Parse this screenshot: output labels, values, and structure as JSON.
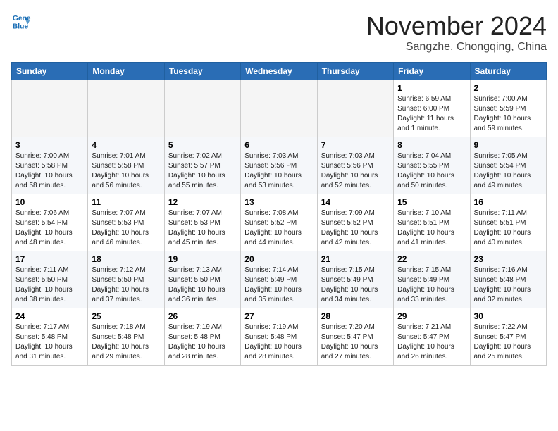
{
  "header": {
    "logo_line1": "General",
    "logo_line2": "Blue",
    "month": "November 2024",
    "location": "Sangzhe, Chongqing, China"
  },
  "weekdays": [
    "Sunday",
    "Monday",
    "Tuesday",
    "Wednesday",
    "Thursday",
    "Friday",
    "Saturday"
  ],
  "weeks": [
    [
      {
        "day": "",
        "info": ""
      },
      {
        "day": "",
        "info": ""
      },
      {
        "day": "",
        "info": ""
      },
      {
        "day": "",
        "info": ""
      },
      {
        "day": "",
        "info": ""
      },
      {
        "day": "1",
        "info": "Sunrise: 6:59 AM\nSunset: 6:00 PM\nDaylight: 11 hours and 1 minute."
      },
      {
        "day": "2",
        "info": "Sunrise: 7:00 AM\nSunset: 5:59 PM\nDaylight: 10 hours and 59 minutes."
      }
    ],
    [
      {
        "day": "3",
        "info": "Sunrise: 7:00 AM\nSunset: 5:58 PM\nDaylight: 10 hours and 58 minutes."
      },
      {
        "day": "4",
        "info": "Sunrise: 7:01 AM\nSunset: 5:58 PM\nDaylight: 10 hours and 56 minutes."
      },
      {
        "day": "5",
        "info": "Sunrise: 7:02 AM\nSunset: 5:57 PM\nDaylight: 10 hours and 55 minutes."
      },
      {
        "day": "6",
        "info": "Sunrise: 7:03 AM\nSunset: 5:56 PM\nDaylight: 10 hours and 53 minutes."
      },
      {
        "day": "7",
        "info": "Sunrise: 7:03 AM\nSunset: 5:56 PM\nDaylight: 10 hours and 52 minutes."
      },
      {
        "day": "8",
        "info": "Sunrise: 7:04 AM\nSunset: 5:55 PM\nDaylight: 10 hours and 50 minutes."
      },
      {
        "day": "9",
        "info": "Sunrise: 7:05 AM\nSunset: 5:54 PM\nDaylight: 10 hours and 49 minutes."
      }
    ],
    [
      {
        "day": "10",
        "info": "Sunrise: 7:06 AM\nSunset: 5:54 PM\nDaylight: 10 hours and 48 minutes."
      },
      {
        "day": "11",
        "info": "Sunrise: 7:07 AM\nSunset: 5:53 PM\nDaylight: 10 hours and 46 minutes."
      },
      {
        "day": "12",
        "info": "Sunrise: 7:07 AM\nSunset: 5:53 PM\nDaylight: 10 hours and 45 minutes."
      },
      {
        "day": "13",
        "info": "Sunrise: 7:08 AM\nSunset: 5:52 PM\nDaylight: 10 hours and 44 minutes."
      },
      {
        "day": "14",
        "info": "Sunrise: 7:09 AM\nSunset: 5:52 PM\nDaylight: 10 hours and 42 minutes."
      },
      {
        "day": "15",
        "info": "Sunrise: 7:10 AM\nSunset: 5:51 PM\nDaylight: 10 hours and 41 minutes."
      },
      {
        "day": "16",
        "info": "Sunrise: 7:11 AM\nSunset: 5:51 PM\nDaylight: 10 hours and 40 minutes."
      }
    ],
    [
      {
        "day": "17",
        "info": "Sunrise: 7:11 AM\nSunset: 5:50 PM\nDaylight: 10 hours and 38 minutes."
      },
      {
        "day": "18",
        "info": "Sunrise: 7:12 AM\nSunset: 5:50 PM\nDaylight: 10 hours and 37 minutes."
      },
      {
        "day": "19",
        "info": "Sunrise: 7:13 AM\nSunset: 5:50 PM\nDaylight: 10 hours and 36 minutes."
      },
      {
        "day": "20",
        "info": "Sunrise: 7:14 AM\nSunset: 5:49 PM\nDaylight: 10 hours and 35 minutes."
      },
      {
        "day": "21",
        "info": "Sunrise: 7:15 AM\nSunset: 5:49 PM\nDaylight: 10 hours and 34 minutes."
      },
      {
        "day": "22",
        "info": "Sunrise: 7:15 AM\nSunset: 5:49 PM\nDaylight: 10 hours and 33 minutes."
      },
      {
        "day": "23",
        "info": "Sunrise: 7:16 AM\nSunset: 5:48 PM\nDaylight: 10 hours and 32 minutes."
      }
    ],
    [
      {
        "day": "24",
        "info": "Sunrise: 7:17 AM\nSunset: 5:48 PM\nDaylight: 10 hours and 31 minutes."
      },
      {
        "day": "25",
        "info": "Sunrise: 7:18 AM\nSunset: 5:48 PM\nDaylight: 10 hours and 29 minutes."
      },
      {
        "day": "26",
        "info": "Sunrise: 7:19 AM\nSunset: 5:48 PM\nDaylight: 10 hours and 28 minutes."
      },
      {
        "day": "27",
        "info": "Sunrise: 7:19 AM\nSunset: 5:48 PM\nDaylight: 10 hours and 28 minutes."
      },
      {
        "day": "28",
        "info": "Sunrise: 7:20 AM\nSunset: 5:47 PM\nDaylight: 10 hours and 27 minutes."
      },
      {
        "day": "29",
        "info": "Sunrise: 7:21 AM\nSunset: 5:47 PM\nDaylight: 10 hours and 26 minutes."
      },
      {
        "day": "30",
        "info": "Sunrise: 7:22 AM\nSunset: 5:47 PM\nDaylight: 10 hours and 25 minutes."
      }
    ]
  ]
}
